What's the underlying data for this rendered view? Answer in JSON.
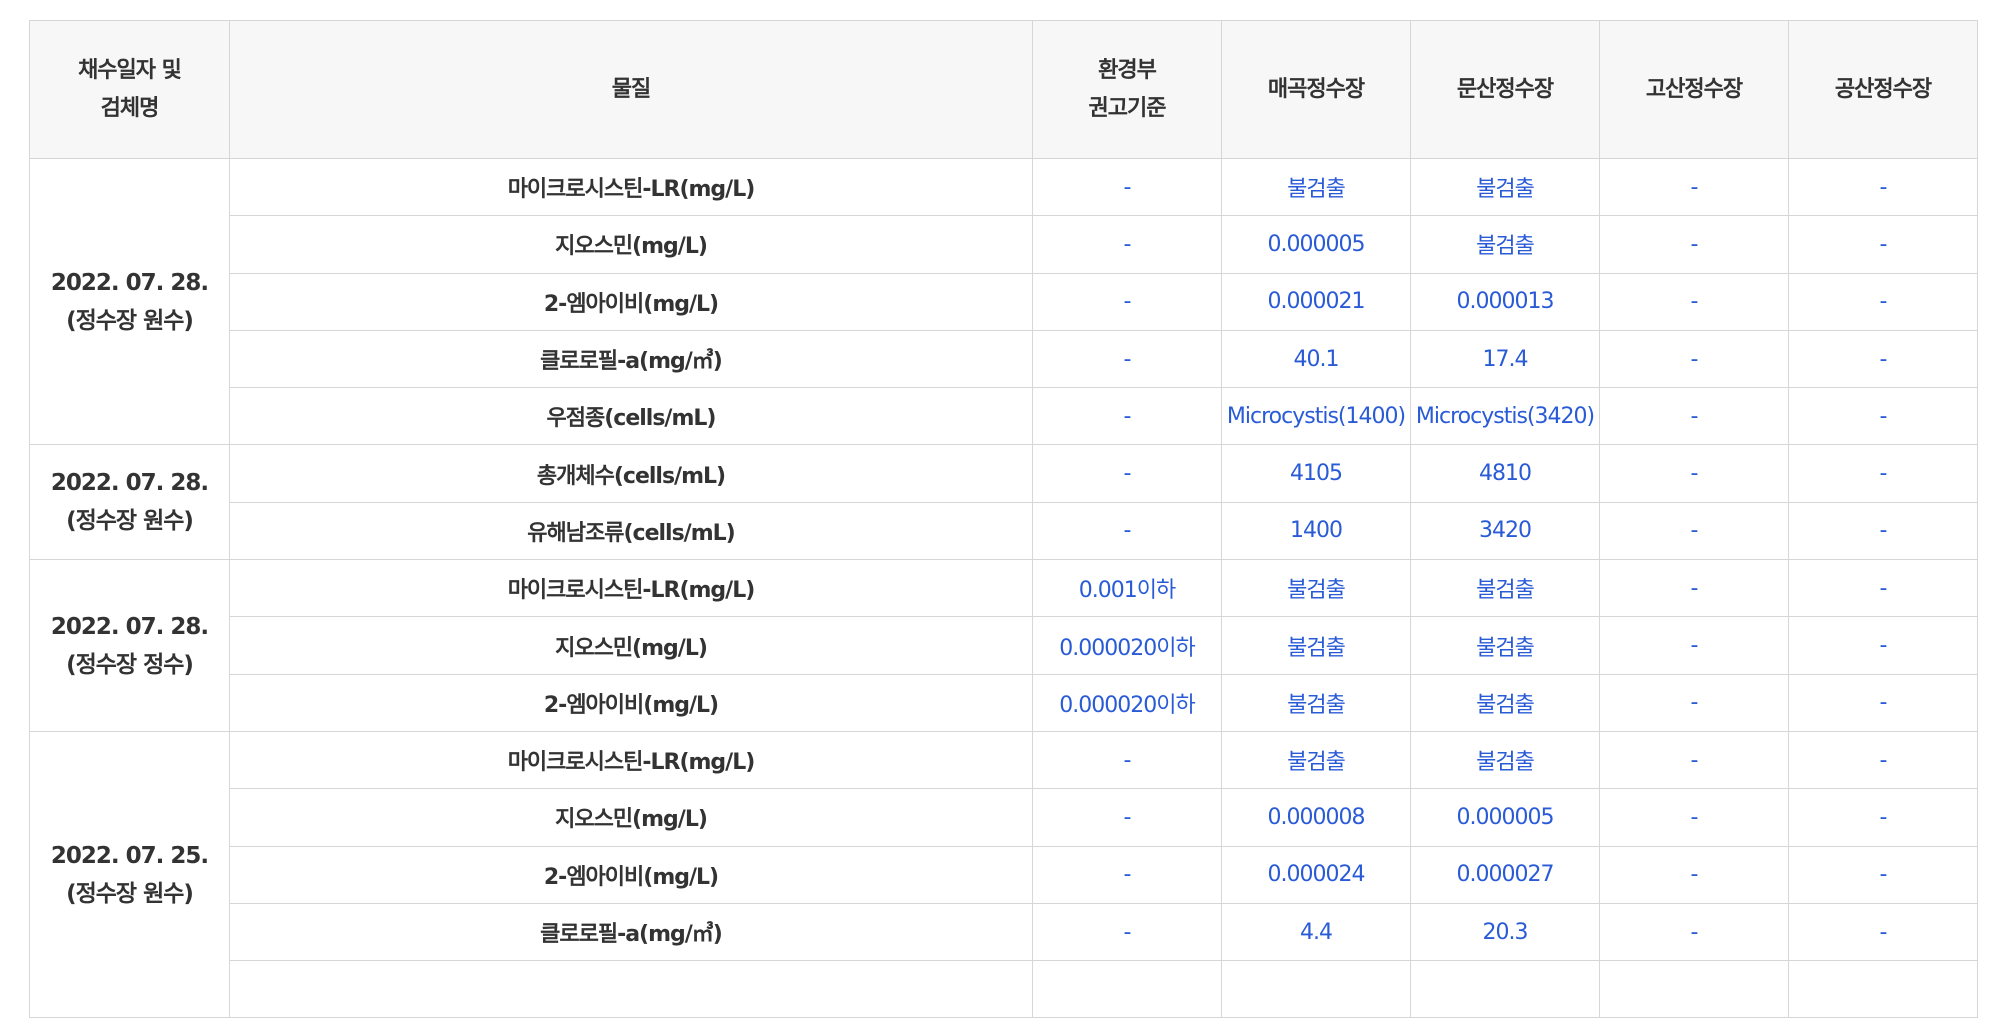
{
  "headers": {
    "date_line1": "채수일자 및",
    "date_line2": "검체명",
    "substance": "물질",
    "standard_line1": "환경부",
    "standard_line2": "권고기준",
    "plant1": "매곡정수장",
    "plant2": "문산정수장",
    "plant3": "고산정수장",
    "plant4": "공산정수장"
  },
  "groups": [
    {
      "date": "2022. 07. 28.",
      "sample": "(정수장 원수)",
      "rows": [
        {
          "substance": "마이크로시스틴-LR(mg/L)",
          "standard": "-",
          "maegok": "불검출",
          "munsan": "불검출",
          "gosan": "-",
          "gongsan": "-"
        },
        {
          "substance": "지오스민(mg/L)",
          "standard": "-",
          "maegok": "0.000005",
          "munsan": "불검출",
          "gosan": "-",
          "gongsan": "-"
        },
        {
          "substance": "2-엠아이비(mg/L)",
          "standard": "-",
          "maegok": "0.000021",
          "munsan": "0.000013",
          "gosan": "-",
          "gongsan": "-"
        },
        {
          "substance": "클로로필-a(mg/㎥)",
          "standard": "-",
          "maegok": "40.1",
          "munsan": "17.4",
          "gosan": "-",
          "gongsan": "-"
        },
        {
          "substance": "우점종(cells/mL)",
          "standard": "-",
          "maegok": "Microcystis(1400)",
          "munsan": "Microcystis(3420)",
          "gosan": "-",
          "gongsan": "-"
        }
      ]
    },
    {
      "date": "2022. 07. 28.",
      "sample": "(정수장 원수)",
      "rows": [
        {
          "substance": "총개체수(cells/mL)",
          "standard": "-",
          "maegok": "4105",
          "munsan": "4810",
          "gosan": "-",
          "gongsan": "-"
        },
        {
          "substance": "유해남조류(cells/mL)",
          "standard": "-",
          "maegok": "1400",
          "munsan": "3420",
          "gosan": "-",
          "gongsan": "-"
        }
      ]
    },
    {
      "date": "2022. 07. 28.",
      "sample": "(정수장 정수)",
      "rows": [
        {
          "substance": "마이크로시스틴-LR(mg/L)",
          "standard": "0.001이하",
          "maegok": "불검출",
          "munsan": "불검출",
          "gosan": "-",
          "gongsan": "-"
        },
        {
          "substance": "지오스민(mg/L)",
          "standard": "0.000020이하",
          "maegok": "불검출",
          "munsan": "불검출",
          "gosan": "-",
          "gongsan": "-"
        },
        {
          "substance": "2-엠아이비(mg/L)",
          "standard": "0.000020이하",
          "maegok": "불검출",
          "munsan": "불검출",
          "gosan": "-",
          "gongsan": "-"
        }
      ]
    },
    {
      "date": "2022. 07. 25.",
      "sample": "(정수장 원수)",
      "rows": [
        {
          "substance": "마이크로시스틴-LR(mg/L)",
          "standard": "-",
          "maegok": "불검출",
          "munsan": "불검출",
          "gosan": "-",
          "gongsan": "-"
        },
        {
          "substance": "지오스민(mg/L)",
          "standard": "-",
          "maegok": "0.000008",
          "munsan": "0.000005",
          "gosan": "-",
          "gongsan": "-"
        },
        {
          "substance": "2-엠아이비(mg/L)",
          "standard": "-",
          "maegok": "0.000024",
          "munsan": "0.000027",
          "gosan": "-",
          "gongsan": "-"
        },
        {
          "substance": "클로로필-a(mg/㎥)",
          "standard": "-",
          "maegok": "4.4",
          "munsan": "20.3",
          "gosan": "-",
          "gongsan": "-"
        },
        {
          "substance": "",
          "standard": "",
          "maegok": "",
          "munsan": "",
          "gosan": "",
          "gongsan": ""
        }
      ]
    }
  ]
}
